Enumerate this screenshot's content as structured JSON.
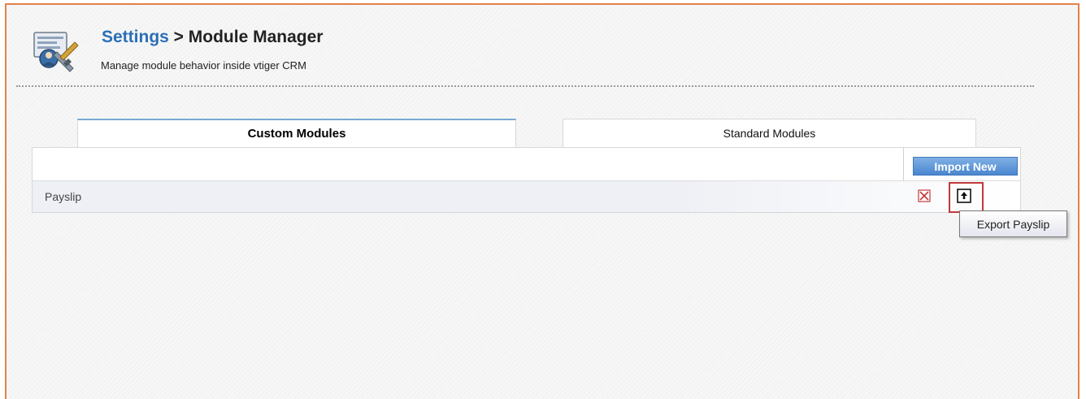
{
  "header": {
    "breadcrumb_link": "Settings",
    "separator": " > ",
    "title": "Module Manager",
    "subtitle": "Manage module behavior inside vtiger CRM",
    "icon": "settings-tools-icon"
  },
  "tabs": [
    {
      "label": "Custom Modules",
      "active": true
    },
    {
      "label": "Standard Modules",
      "active": false
    }
  ],
  "toolbar": {
    "import_label": "Import New"
  },
  "modules": [
    {
      "name": "Payslip",
      "delete_icon": "delete-x-icon",
      "export_icon": "export-up-arrow-icon"
    }
  ],
  "tooltip": {
    "text": "Export Payslip"
  },
  "colors": {
    "accent": "#2a6fb6",
    "frame_border": "#e2834a",
    "highlight": "#c0383a",
    "button": "#4a86cf"
  }
}
